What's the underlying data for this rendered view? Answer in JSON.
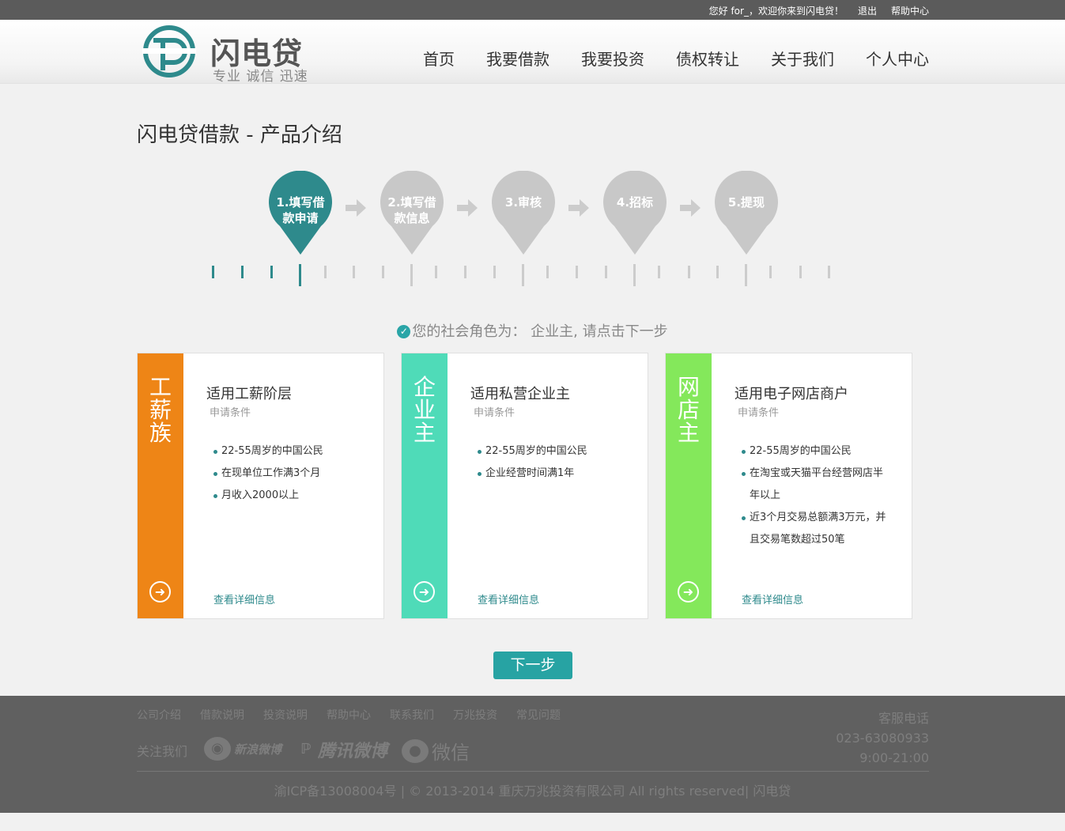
{
  "topbar": {
    "greeting": "您好 for_，欢迎你来到闪电贷！",
    "logout": "退出",
    "help": "帮助中心"
  },
  "logo": {
    "name": "闪电贷",
    "slogan": "专业 诚信 迅速",
    "colors": {
      "teal": "#2e8a8c"
    }
  },
  "nav": [
    "首页",
    "我要借款",
    "我要投资",
    "债权转让",
    "关于我们",
    "个人中心"
  ],
  "page_title": "闪电贷借款 - 产品介绍",
  "steps": [
    {
      "line1": "1.填写借",
      "line2": "款申请",
      "active": true
    },
    {
      "line1": "2.填写借",
      "line2": "款信息",
      "active": false
    },
    {
      "line1": "3.审核",
      "line2": "",
      "active": false
    },
    {
      "line1": "4.招标",
      "line2": "",
      "active": false
    },
    {
      "line1": "5.提现",
      "line2": "",
      "active": false
    }
  ],
  "step_colors": {
    "active": "#2e8a8c",
    "inactive": "#c8c8c8"
  },
  "notice": {
    "icon": "check-circle-icon",
    "text": "您的社会角色为： 企业主, 请点击下一步"
  },
  "cards": [
    {
      "band_label": "工薪族",
      "band_color": "#ee8516",
      "title": "适用工薪阶层",
      "subtitle": "申请条件",
      "conditions": [
        "22-55周岁的中国公民",
        "在现单位工作满3个月",
        "月收入2000以上"
      ],
      "detail_link": "查看详细信息",
      "icon": "arrow-right-circle-icon"
    },
    {
      "band_label": "企业主",
      "band_color": "#4fdbb8",
      "title": "适用私营企业主",
      "subtitle": "申请条件",
      "conditions": [
        "22-55周岁的中国公民",
        "企业经营时间满1年"
      ],
      "detail_link": "查看详细信息",
      "icon": "arrow-right-circle-icon"
    },
    {
      "band_label": "网店主",
      "band_color": "#84e85b",
      "title": "适用电子网店商户",
      "subtitle": "申请条件",
      "conditions": [
        "22-55周岁的中国公民",
        "在淘宝或天猫平台经营网店半年以上",
        "近3个月交易总额满3万元，并且交易笔数超过50笔"
      ],
      "detail_link": "查看详细信息",
      "icon": "arrow-right-circle-icon"
    }
  ],
  "next_button": "下一步",
  "footer": {
    "links": [
      "公司介绍",
      "借款说明",
      "投资说明",
      "帮助中心",
      "联系我们",
      "万兆投资",
      "常见问题"
    ],
    "follow_label": "关注我们",
    "social": [
      {
        "name": "新浪微博",
        "icon": "weibo-icon"
      },
      {
        "name": "腾讯微博",
        "icon": "tencent-weibo-icon"
      },
      {
        "name": "微信",
        "icon": "wechat-icon"
      }
    ],
    "contact_title": "客服电话",
    "phone": "023-63080933",
    "hours": "9:00-21:00",
    "copyright": "渝ICP备13008004号 | © 2013-2014 重庆万兆投资有限公司 All rights reserved| 闪电贷"
  }
}
